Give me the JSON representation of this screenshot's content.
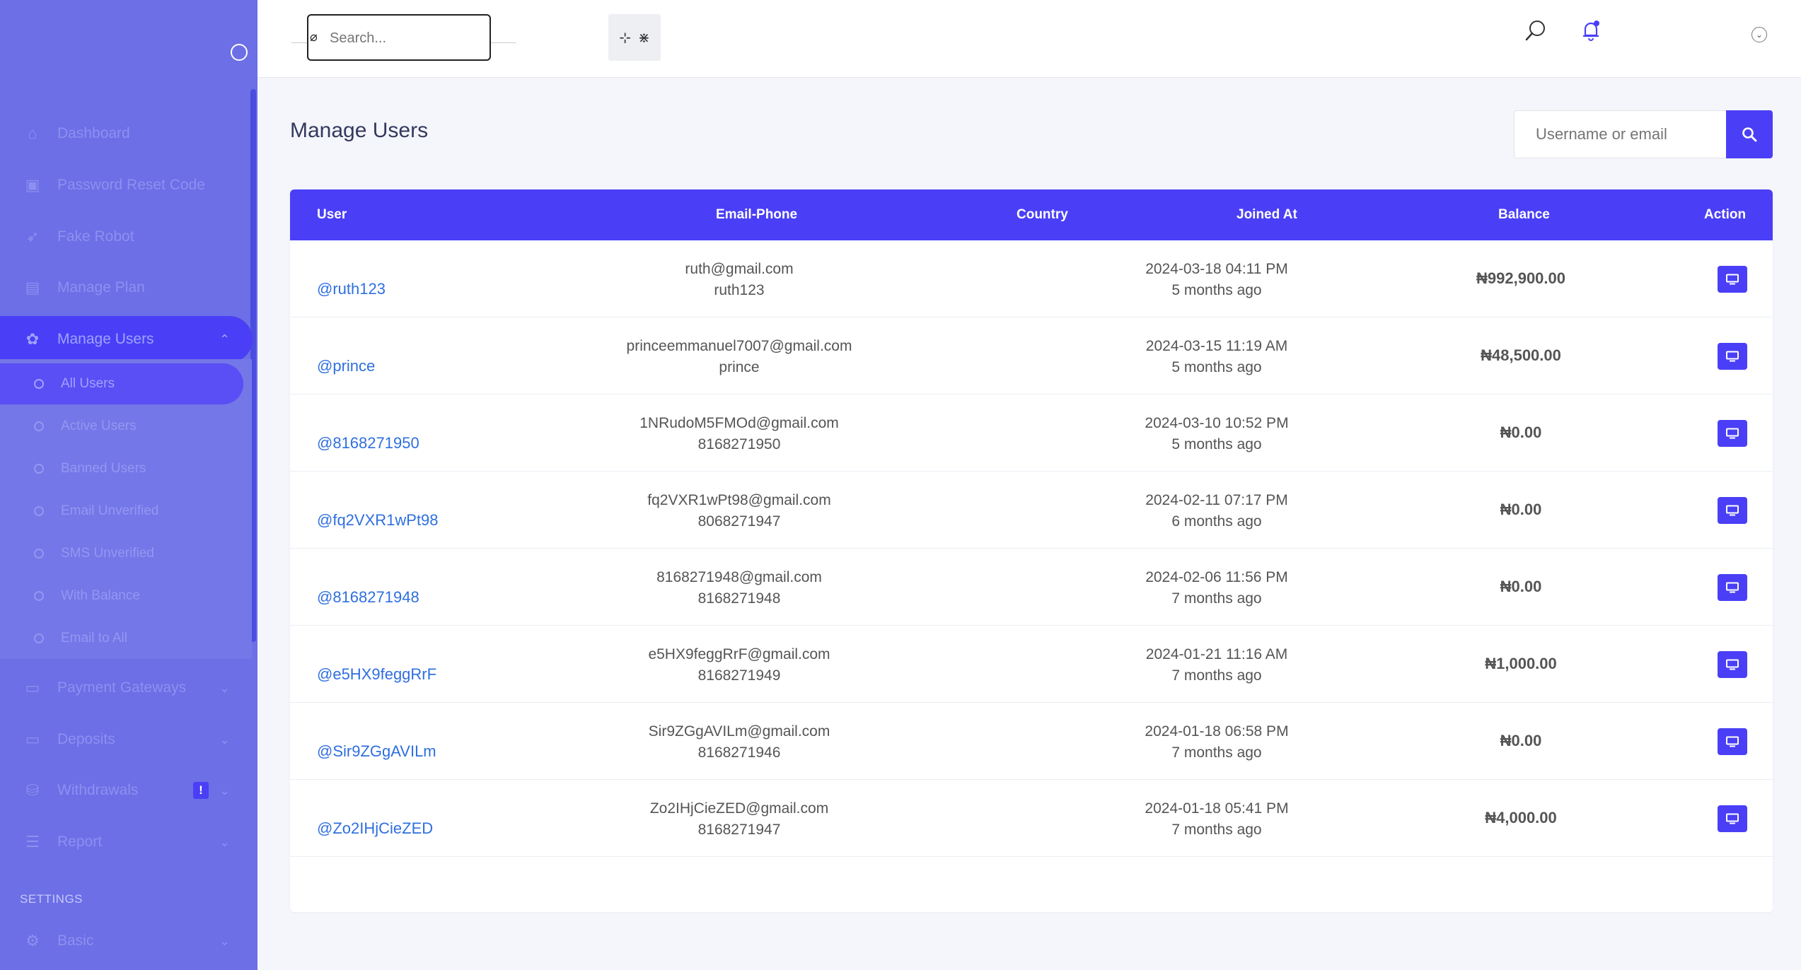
{
  "sidebar": {
    "items": [
      {
        "label": "Dashboard",
        "icon": "home-icon"
      },
      {
        "label": "Password Reset Code",
        "icon": "lock-icon"
      },
      {
        "label": "Fake Robot",
        "icon": "rocket-icon"
      },
      {
        "label": "Manage Plan",
        "icon": "briefcase-icon"
      },
      {
        "label": "Manage Users",
        "icon": "users-icon"
      },
      {
        "label": "Payment Gateways",
        "icon": "credit-card-icon"
      },
      {
        "label": "Deposits",
        "icon": "wallet-icon"
      },
      {
        "label": "Withdrawals",
        "icon": "bank-icon",
        "badge": "!"
      },
      {
        "label": "Report",
        "icon": "list-icon"
      },
      {
        "label": "Basic",
        "icon": "gear-icon"
      }
    ],
    "subitems": [
      "All Users",
      "Active Users",
      "Banned Users",
      "Email Unverified",
      "SMS Unverified",
      "With Balance",
      "Email to All"
    ],
    "settings_label": "SETTINGS"
  },
  "header": {
    "search_placeholder": "Search..."
  },
  "main": {
    "title": "Manage Users",
    "search_placeholder": "Username or email",
    "columns": [
      "User",
      "Email-Phone",
      "Country",
      "Joined At",
      "Balance",
      "Action"
    ],
    "rows": [
      {
        "user": "@ruth123",
        "email": "ruth@gmail.com",
        "phone": "ruth123",
        "country": "",
        "date": "2024-03-18 04:11 PM",
        "ago": "5 months ago",
        "balance": "₦992,900.00"
      },
      {
        "user": "@prince",
        "email": "princeemmanuel7007@gmail.com",
        "phone": "prince",
        "country": "",
        "date": "2024-03-15 11:19 AM",
        "ago": "5 months ago",
        "balance": "₦48,500.00"
      },
      {
        "user": "@8168271950",
        "email": "1NRudoM5FMOd@gmail.com",
        "phone": "8168271950",
        "country": "",
        "date": "2024-03-10 10:52 PM",
        "ago": "5 months ago",
        "balance": "₦0.00"
      },
      {
        "user": "@fq2VXR1wPt98",
        "email": "fq2VXR1wPt98@gmail.com",
        "phone": "8068271947",
        "country": "",
        "date": "2024-02-11 07:17 PM",
        "ago": "6 months ago",
        "balance": "₦0.00"
      },
      {
        "user": "@8168271948",
        "email": "8168271948@gmail.com",
        "phone": "8168271948",
        "country": "",
        "date": "2024-02-06 11:56 PM",
        "ago": "7 months ago",
        "balance": "₦0.00"
      },
      {
        "user": "@e5HX9feggRrF",
        "email": "e5HX9feggRrF@gmail.com",
        "phone": "8168271949",
        "country": "",
        "date": "2024-01-21 11:16 AM",
        "ago": "7 months ago",
        "balance": "₦1,000.00"
      },
      {
        "user": "@Sir9ZGgAVILm",
        "email": "Sir9ZGgAVILm@gmail.com",
        "phone": "8168271946",
        "country": "",
        "date": "2024-01-18 06:58 PM",
        "ago": "7 months ago",
        "balance": "₦0.00"
      },
      {
        "user": "@Zo2IHjCieZED",
        "email": "Zo2IHjCieZED@gmail.com",
        "phone": "8168271947",
        "country": "",
        "date": "2024-01-18 05:41 PM",
        "ago": "7 months ago",
        "balance": "₦4,000.00"
      }
    ]
  },
  "colors": {
    "primary": "#4a3ff6",
    "sidebar": "#6c6fe6",
    "link": "#2f6fdf"
  }
}
